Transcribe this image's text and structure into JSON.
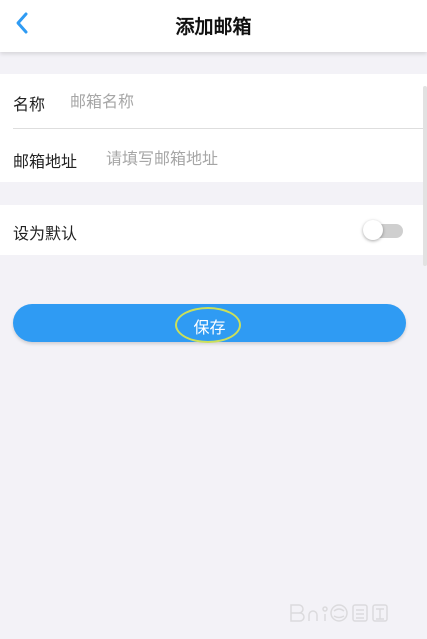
{
  "header": {
    "title": "添加邮箱"
  },
  "form": {
    "name_label": "名称",
    "name_placeholder": "邮箱名称",
    "address_label": "邮箱地址",
    "address_placeholder": "请填写邮箱地址",
    "default_label": "设为默认",
    "default_enabled": false
  },
  "actions": {
    "save_label": "保存"
  },
  "colors": {
    "accent": "#2f9bf3",
    "back_icon": "#2f9bf3",
    "highlight_ring": "#cbe05a",
    "background": "#f3f2f7"
  },
  "icons": {
    "back": "chevron-left-icon",
    "watermark": "baidu-jingyan-logo"
  }
}
